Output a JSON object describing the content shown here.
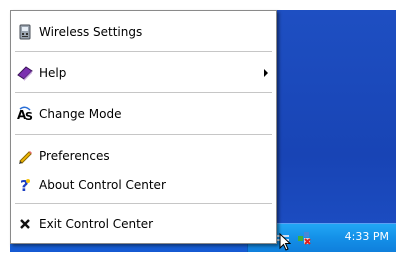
{
  "menu": {
    "items": [
      {
        "label": "Wireless Settings",
        "icon": "wireless-settings-icon"
      },
      {
        "label": "Help",
        "icon": "help-book-icon",
        "submenu": true
      },
      {
        "label": "Change Mode",
        "icon": "change-mode-icon"
      },
      {
        "label": "Preferences",
        "icon": "pencil-icon"
      },
      {
        "label": "About Control Center",
        "icon": "question-icon"
      },
      {
        "label": "Exit Control Center",
        "icon": "close-x-icon"
      }
    ]
  },
  "taskbar": {
    "clock": "4:33 PM",
    "colors": {
      "desktop": "#1844b5",
      "taskbar": "#1c6be0",
      "tray": "#1490e8"
    }
  }
}
